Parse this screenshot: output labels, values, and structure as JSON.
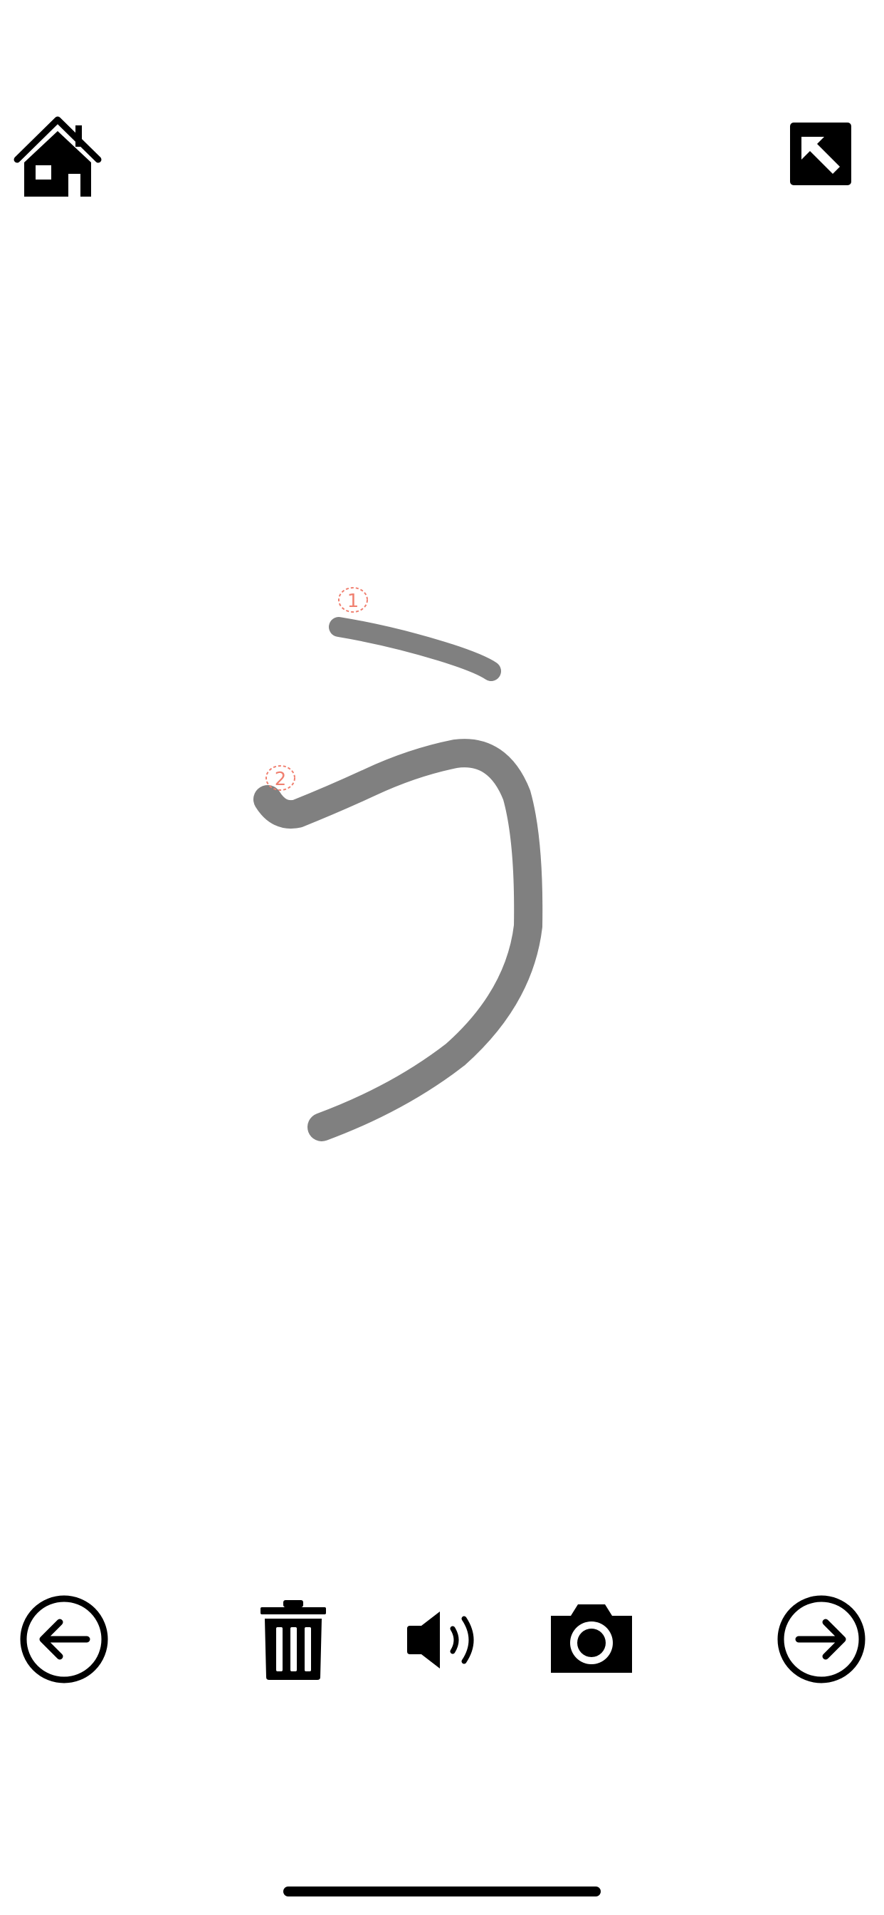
{
  "toolbar_top": {
    "home_icon": "home-icon",
    "expand_icon": "expand-arrow-icon"
  },
  "character": {
    "kana": "う",
    "stroke_color": "#808080",
    "marker_color": "#f08070",
    "strokes": [
      {
        "order": "1"
      },
      {
        "order": "2"
      }
    ]
  },
  "toolbar_bottom": {
    "prev_icon": "arrow-left-circle-icon",
    "trash_icon": "trash-icon",
    "sound_icon": "speaker-icon",
    "camera_icon": "camera-icon",
    "next_icon": "arrow-right-circle-icon"
  }
}
